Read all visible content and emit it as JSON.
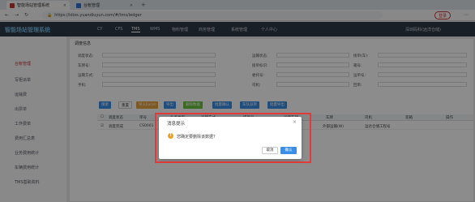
{
  "browser": {
    "tabs": [
      {
        "title": "智能场站管理系统"
      },
      {
        "title": "台帐管理"
      }
    ],
    "url": "https://idios.yuandiuyun.com/#/tms/ledger",
    "login_label": "登录"
  },
  "header": {
    "brand": "智能场站管理系统",
    "nav": [
      "CY",
      "CFS",
      "TMS",
      "WMS",
      "物料管理",
      "商务管理",
      "系统管理",
      "个人中心"
    ],
    "user": "深圳码科(远洋仓储)"
  },
  "sidebar": {
    "items": [
      "台帐管理",
      "写柜派单",
      "运输费",
      "出票单",
      "工作费单",
      "费用汇总表",
      "业务费用统计",
      "车辆费用统计",
      "TMS基础资料"
    ]
  },
  "content": {
    "title": "调度信息",
    "filters": {
      "row1": [
        "调度状态:",
        "运输状态:",
        "接单(车):",
        "单据状:"
      ],
      "row2": [
        "车牌号:",
        "接单标识:",
        "箱号:"
      ],
      "row3": [
        "运输方式:",
        "委托号:",
        "运单号:",
        "客户号:",
        "提单号:"
      ],
      "row4": [
        "手机:",
        "司机:",
        "回单:"
      ]
    },
    "buttons": [
      "搜索",
      "重置",
      "导入Excel",
      "导出",
      "删除数据",
      "批量确认",
      "车队派单",
      "批量导出"
    ],
    "table_headers": [
      "调度状态",
      "单号",
      "业务类型",
      "运输方式",
      "提单号",
      "运输车辆",
      "车牌",
      "司机",
      "装箱",
      "操作"
    ],
    "row": {
      "status": "调度完成",
      "code": "CS0001",
      "route": "外部运输(W)",
      "shipper": "运达仓储工程号"
    }
  },
  "dialog": {
    "title": "消息提示",
    "close": "×",
    "message": "您确定要删除该数据?",
    "cancel": "取消",
    "confirm": "确认",
    "icon": "warning-icon"
  }
}
